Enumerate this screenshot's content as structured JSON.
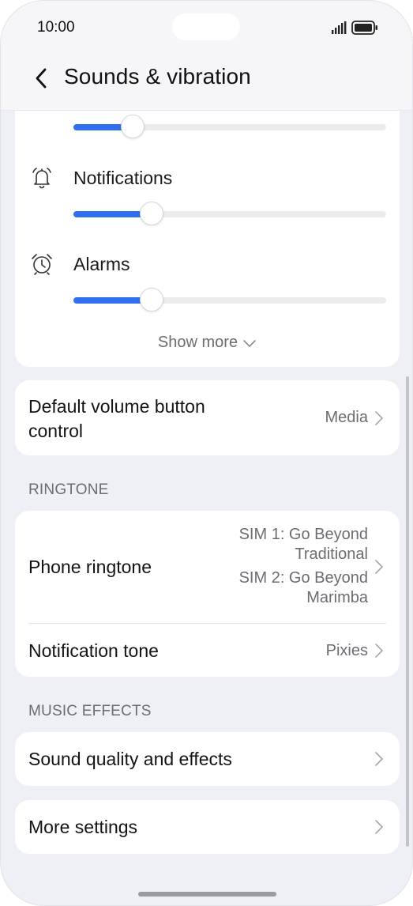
{
  "status_bar": {
    "time": "10:00",
    "signal_icon": "signal-icon",
    "battery_icon": "battery-icon"
  },
  "header": {
    "back_icon": "back-arrow-icon",
    "title": "Sounds & vibration"
  },
  "volume": {
    "rows": [
      {
        "label": "",
        "icon": "media-icon",
        "level": 0.19
      },
      {
        "label": "Notifications",
        "icon": "bell-icon",
        "level": 0.25
      },
      {
        "label": "Alarms",
        "icon": "alarm-clock-icon",
        "level": 0.25
      }
    ],
    "show_more": "Show more"
  },
  "default_volume": {
    "title_line1": "Default volume button",
    "title_line2": "control",
    "value": "Media"
  },
  "ringtone_section": {
    "label": "RINGTONE",
    "phone_ringtone": {
      "title": "Phone ringtone",
      "value_lines": [
        "SIM 1: Go Beyond",
        "Traditional",
        "SIM 2: Go Beyond",
        "Marimba"
      ]
    },
    "notification_tone": {
      "title": "Notification tone",
      "value": "Pixies"
    }
  },
  "music_section": {
    "label": "MUSIC EFFECTS",
    "sound_quality": {
      "title": "Sound quality and effects"
    }
  },
  "more_settings": {
    "title": "More settings"
  },
  "colors": {
    "accent": "#2f6ff0",
    "background": "#eff0f5",
    "card": "#ffffff",
    "secondary_text": "#6b6d72"
  }
}
